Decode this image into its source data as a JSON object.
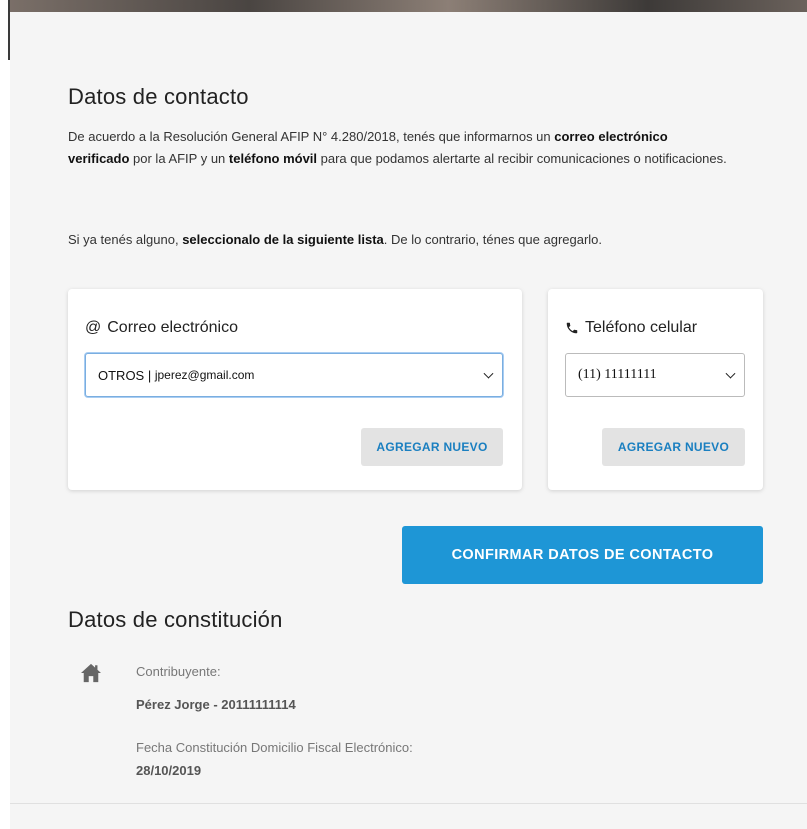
{
  "contact": {
    "title": "Datos de contacto",
    "para1_a": "De acuerdo a la Resolución General AFIP N° 4.280/2018, tenés que informarnos un ",
    "para1_b": "correo electrónico verificado",
    "para1_c": " por la AFIP y un ",
    "para1_d": "teléfono móvil",
    "para1_e": " para que podamos alertarte al recibir comunicaciones o notificaciones.",
    "para2_a": "Si ya tenés alguno, ",
    "para2_b": "seleccionalo de la siguiente lista",
    "para2_c": ". De lo contrario, ténes que agregarlo."
  },
  "email_card": {
    "icon_text": "@",
    "title": "Correo electrónico",
    "select_prefix": "OTROS | ",
    "select_value": "jperez@gmail.com",
    "add_label": "AGREGAR NUEVO"
  },
  "phone_card": {
    "icon": "phone-icon",
    "title": "Teléfono celular",
    "select_value": "(11) 11111111",
    "add_label": "AGREGAR NUEVO"
  },
  "confirm_label": "CONFIRMAR DATOS DE CONTACTO",
  "constitution": {
    "title": "Datos de constitución",
    "icon": "home-icon",
    "taxpayer_label": "Contribuyente:",
    "taxpayer_value": "Pérez Jorge - 20111111114",
    "date_label": "Fecha Constitución Domicilio Fiscal Electrónico:",
    "date_value": "28/10/2019"
  },
  "colors": {
    "primary": "#1e96d6",
    "link": "#1a7fc0",
    "panel_bg": "#f5f5f5"
  }
}
